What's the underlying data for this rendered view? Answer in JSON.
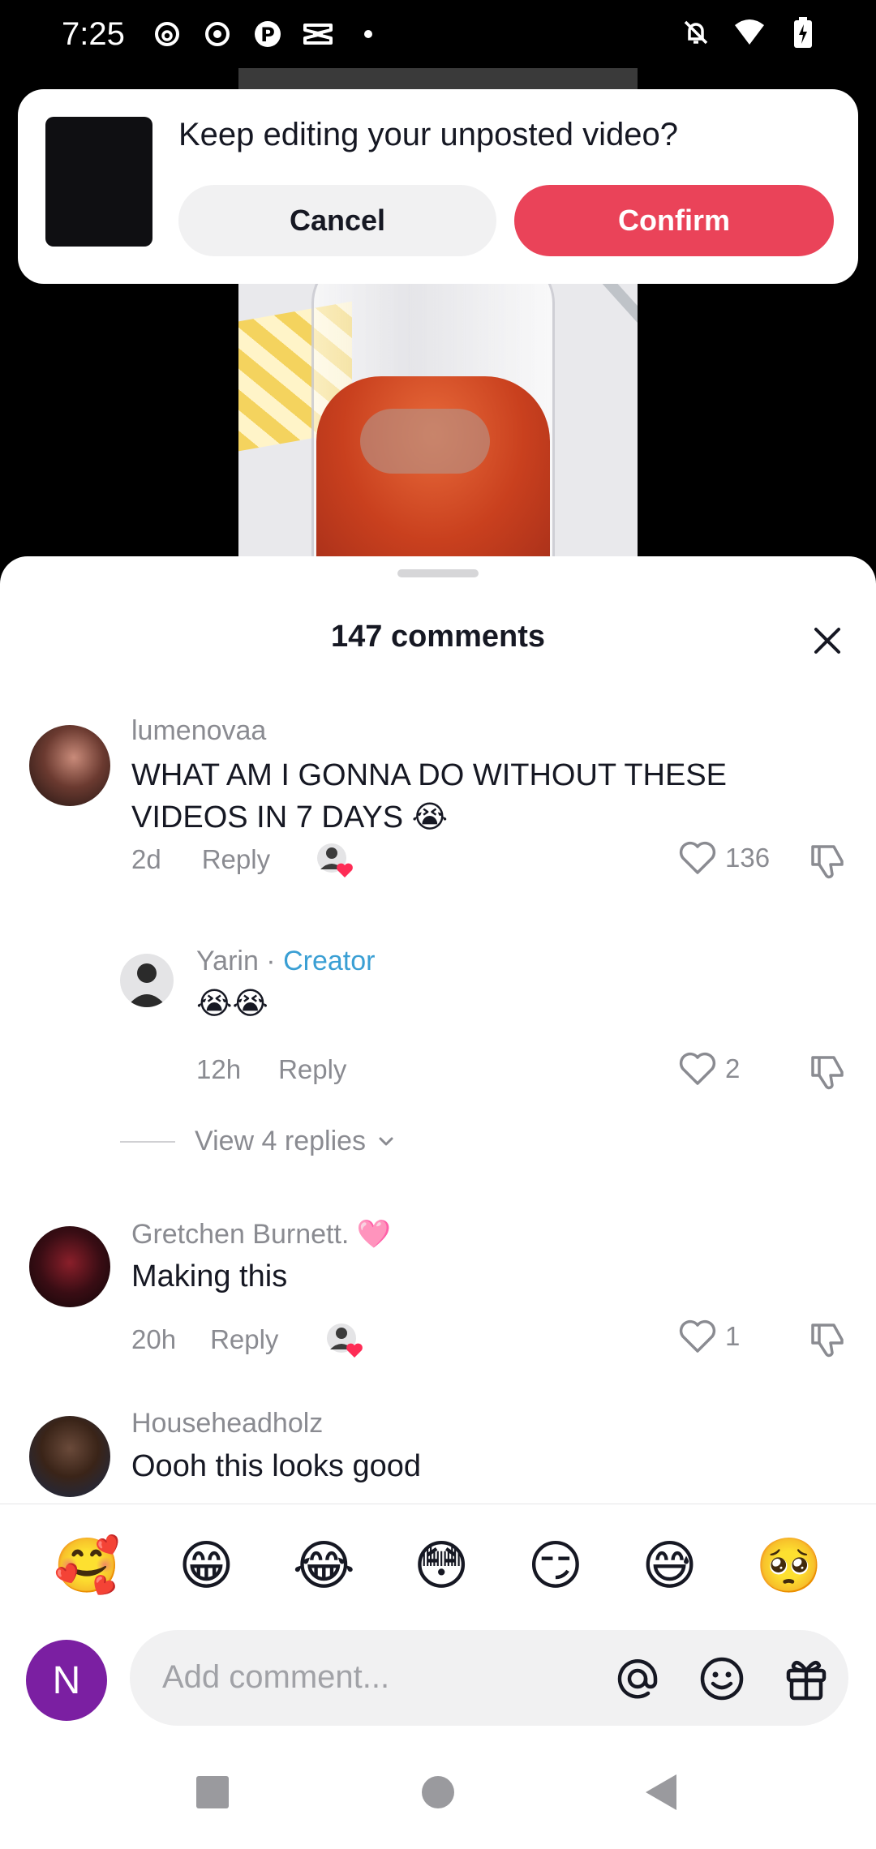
{
  "status_bar": {
    "time": "7:25"
  },
  "dialog": {
    "title": "Keep editing your unposted video?",
    "cancel_label": "Cancel",
    "confirm_label": "Confirm"
  },
  "comments_sheet": {
    "title": "147 comments",
    "comments": [
      {
        "username": "lumenovaa",
        "text": "WHAT AM I GONNA DO WITHOUT THESE VIDEOS IN 7 DAYS 😭",
        "age": "2d",
        "reply_label": "Reply",
        "likes": "136"
      },
      {
        "username": "Yarin",
        "separator": " · ",
        "badge": "Creator",
        "text": "😭😭",
        "age": "12h",
        "reply_label": "Reply",
        "likes": "2"
      },
      {
        "username": "Gretchen Burnett.",
        "name_emoji": "🩷",
        "text": "Making this",
        "age": "20h",
        "reply_label": "Reply",
        "likes": "1"
      },
      {
        "username": "Househeadholz",
        "text": "Oooh this looks good"
      }
    ],
    "view_replies": "View 4 replies"
  },
  "emoji_bar": [
    "🥰",
    "😁",
    "😂",
    "😳",
    "😏",
    "😅",
    "🥺"
  ],
  "composer": {
    "avatar_letter": "N",
    "placeholder": "Add comment..."
  },
  "colors": {
    "accent": "#ea4359",
    "creator": "#3a9fd4",
    "avatar": "#7b1fa2"
  }
}
